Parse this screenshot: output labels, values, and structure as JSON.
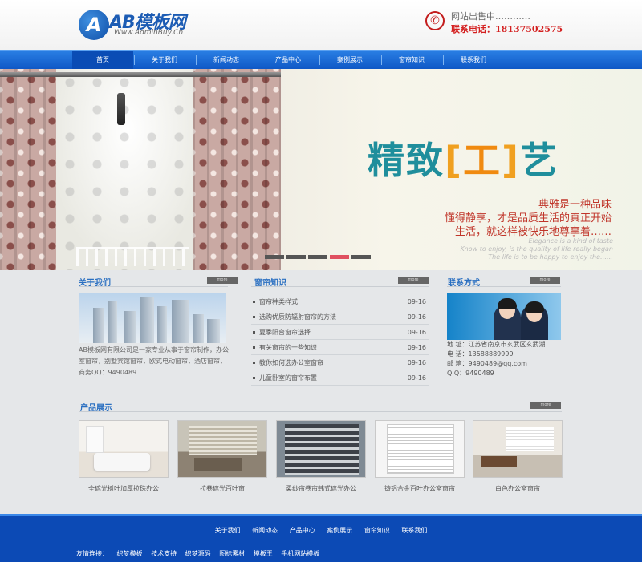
{
  "header": {
    "logo_mark": "A",
    "logo_text": "AB模板网",
    "logo_url": "Www.AdminBuy.Cn",
    "sale_text": "网站出售中…………",
    "tel_text": "联系电话：18137502575"
  },
  "nav": {
    "items": [
      "首页",
      "关于我们",
      "新闻动态",
      "产品中心",
      "案例展示",
      "窗帘知识",
      "联系我们"
    ]
  },
  "banner": {
    "headline_a": "精致",
    "bracket_l": "[",
    "headline_mid": "工",
    "bracket_r": "]",
    "headline_b": "艺",
    "line1": "典雅是一种品味",
    "line2": "懂得静享，才是品质生活的真正开始",
    "line3": "生活，就这样被快乐地尊享着……",
    "eng1": "Elegance is a kind of taste",
    "eng2": "Know to enjoy, is the quality of life really began",
    "eng3": "The life is to be happy to enjoy the……"
  },
  "about": {
    "title": "关于我们",
    "more": "more",
    "text": "AB模板网有限公司是一家专业从事于窗帘制作，办公室窗帘，别墅宾馆窗帘，欧式电动窗帘，酒店窗帘，商务QQ：9490489"
  },
  "news": {
    "title": "窗帘知识",
    "more": "more",
    "items": [
      {
        "title": "窗帘种类样式",
        "date": "09-16"
      },
      {
        "title": "选购优质防辐射窗帘的方法",
        "date": "09-16"
      },
      {
        "title": "夏季阳台窗帘选择",
        "date": "09-16"
      },
      {
        "title": "有关窗帘的一些知识",
        "date": "09-16"
      },
      {
        "title": "教你如何选办公室窗帘",
        "date": "09-16"
      },
      {
        "title": "儿童卧室的窗帘布置",
        "date": "09-16"
      }
    ]
  },
  "contact": {
    "title": "联系方式",
    "more": "more",
    "address": "地 址：江苏省南京市玄武区玄武湖",
    "phone": "电 话：13588889999",
    "email": "邮 箱：9490489@qq.com",
    "qq": "Q Q：9490489"
  },
  "products": {
    "title": "产品展示",
    "more": "more",
    "items": [
      {
        "name": "全遮光树叶加厚拉珠办公"
      },
      {
        "name": "拉卷遮光百叶窗"
      },
      {
        "name": "柔纱帘卷帘韩式遮光办公"
      },
      {
        "name": "铸铝合金百叶办公室窗帘"
      },
      {
        "name": "白色办公室窗帘"
      }
    ]
  },
  "footer": {
    "links": [
      "关于我们",
      "新闻动态",
      "产品中心",
      "案例展示",
      "窗帘知识",
      "联系我们"
    ],
    "friend_label": "友情连接：",
    "friend_links": [
      "织梦模板",
      "技术支持",
      "织梦源码",
      "图标素材",
      "模板王",
      "手机网站模板"
    ]
  },
  "colors": {
    "nav_blue": "#1164d2",
    "footer_blue": "#0c4ab5",
    "accent_red": "#d42020",
    "title_blue": "#2a6fc1"
  }
}
